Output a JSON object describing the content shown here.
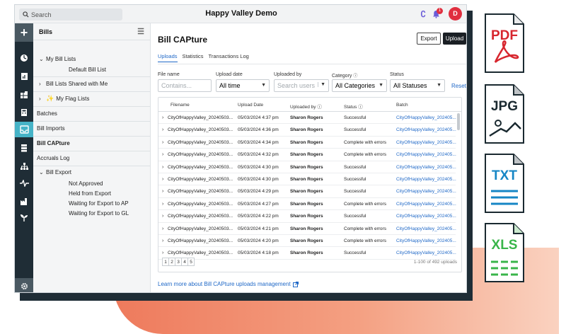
{
  "app": {
    "title": "Happy Valley Demo",
    "search_placeholder": "Search",
    "avatar_initial": "D",
    "notification_count": "1"
  },
  "sidebar": {
    "title": "Bills",
    "items": [
      {
        "label": "My Bill Lists",
        "chevron": "down"
      },
      {
        "label": "Default Bill List"
      },
      {
        "label": "Bill Lists Shared with Me",
        "chevron": "right"
      },
      {
        "label": "My Flag Lists",
        "chevron": "right"
      },
      {
        "label": "Batches"
      },
      {
        "label": "Bill Imports"
      },
      {
        "label": "Bill CAPture"
      },
      {
        "label": "Accruals Log"
      },
      {
        "label": "Bill Export",
        "chevron": "down"
      },
      {
        "label": "Not Approved"
      },
      {
        "label": "Held from Export"
      },
      {
        "label": "Waiting for Export to AP"
      },
      {
        "label": "Waiting for Export to GL"
      }
    ]
  },
  "main": {
    "title": "Bill CAPture",
    "export_label": "Export",
    "upload_label": "Upload",
    "tabs": [
      "Uploads",
      "Statistics",
      "Transactions Log"
    ],
    "filters": {
      "file_name_label": "File name",
      "file_name_placeholder": "Contains...",
      "upload_date_label": "Upload date",
      "upload_date_value": "All time",
      "uploaded_by_label": "Uploaded by",
      "uploaded_by_placeholder": "Search users",
      "category_label": "Category",
      "category_value": "All Categories",
      "status_label": "Status",
      "status_value": "All Statuses",
      "reset_label": "Reset"
    },
    "table": {
      "headers": [
        "Filename",
        "Upload Date",
        "Uploaded by",
        "Status",
        "Batch"
      ],
      "rows": [
        [
          "CityOfHappyValley_20240503...",
          "05/03/2024 4:37 pm",
          "Sharon Rogers",
          "Successful",
          "CityOfHappyValley_202405..."
        ],
        [
          "CityOfHappyValley_20240503...",
          "05/03/2024 4:36 pm",
          "Sharon Rogers",
          "Successful",
          "CityOfHappyValley_202405..."
        ],
        [
          "CityOfHappyValley_20240503...",
          "05/03/2024 4:34 pm",
          "Sharon Rogers",
          "Complete with errors",
          "CityOfHappyValley_202405..."
        ],
        [
          "CityOfHappyValley_20240503...",
          "05/03/2024 4:32 pm",
          "Sharon Rogers",
          "Complete with errors",
          "CityOfHappyValley_202405..."
        ],
        [
          "CityOfHappyValley_20240503...",
          "05/03/2024 4:30 pm",
          "Sharon Rogers",
          "Successful",
          "CityOfHappyValley_202405..."
        ],
        [
          "CityOfHappyValley_20240503...",
          "05/03/2024 4:30 pm",
          "Sharon Rogers",
          "Successful",
          "CityOfHappyValley_202405..."
        ],
        [
          "CityOfHappyValley_20240503...",
          "05/03/2024 4:29 pm",
          "Sharon Rogers",
          "Successful",
          "CityOfHappyValley_202405..."
        ],
        [
          "CityOfHappyValley_20240503...",
          "05/03/2024 4:27 pm",
          "Sharon Rogers",
          "Complete with errors",
          "CityOfHappyValley_202405..."
        ],
        [
          "CityOfHappyValley_20240503...",
          "05/03/2024 4:22 pm",
          "Sharon Rogers",
          "Successful",
          "CityOfHappyValley_202405..."
        ],
        [
          "CityOfHappyValley_20240503...",
          "05/03/2024 4:21 pm",
          "Sharon Rogers",
          "Complete with errors",
          "CityOfHappyValley_202405..."
        ],
        [
          "CityOfHappyValley_20240503...",
          "05/03/2024 4:20 pm",
          "Sharon Rogers",
          "Complete with errors",
          "CityOfHappyValley_202405..."
        ],
        [
          "CityOfHappyValley_20240503...",
          "05/03/2024 4:18 pm",
          "Sharon Rogers",
          "Successful",
          "CityOfHappyValley_202405..."
        ]
      ]
    },
    "pages": [
      "1",
      "2",
      "3",
      "4",
      "5"
    ],
    "pagination_info": "1-100 of 492 uploads",
    "learn_more": "Learn more about Bill CAPture uploads management"
  },
  "file_icons": {
    "pdf": {
      "label": "PDF",
      "color": "#d7262e"
    },
    "jpg": {
      "label": "JPG",
      "color": "#1a2930"
    },
    "txt": {
      "label": "TXT",
      "color": "#1686c5"
    },
    "xls": {
      "label": "XLS",
      "color": "#39b54a"
    }
  },
  "colors": {
    "accent": "#46b3c7",
    "link": "#1f68c7",
    "rail": "#1f2d36",
    "brand_red": "#e02f3f"
  }
}
